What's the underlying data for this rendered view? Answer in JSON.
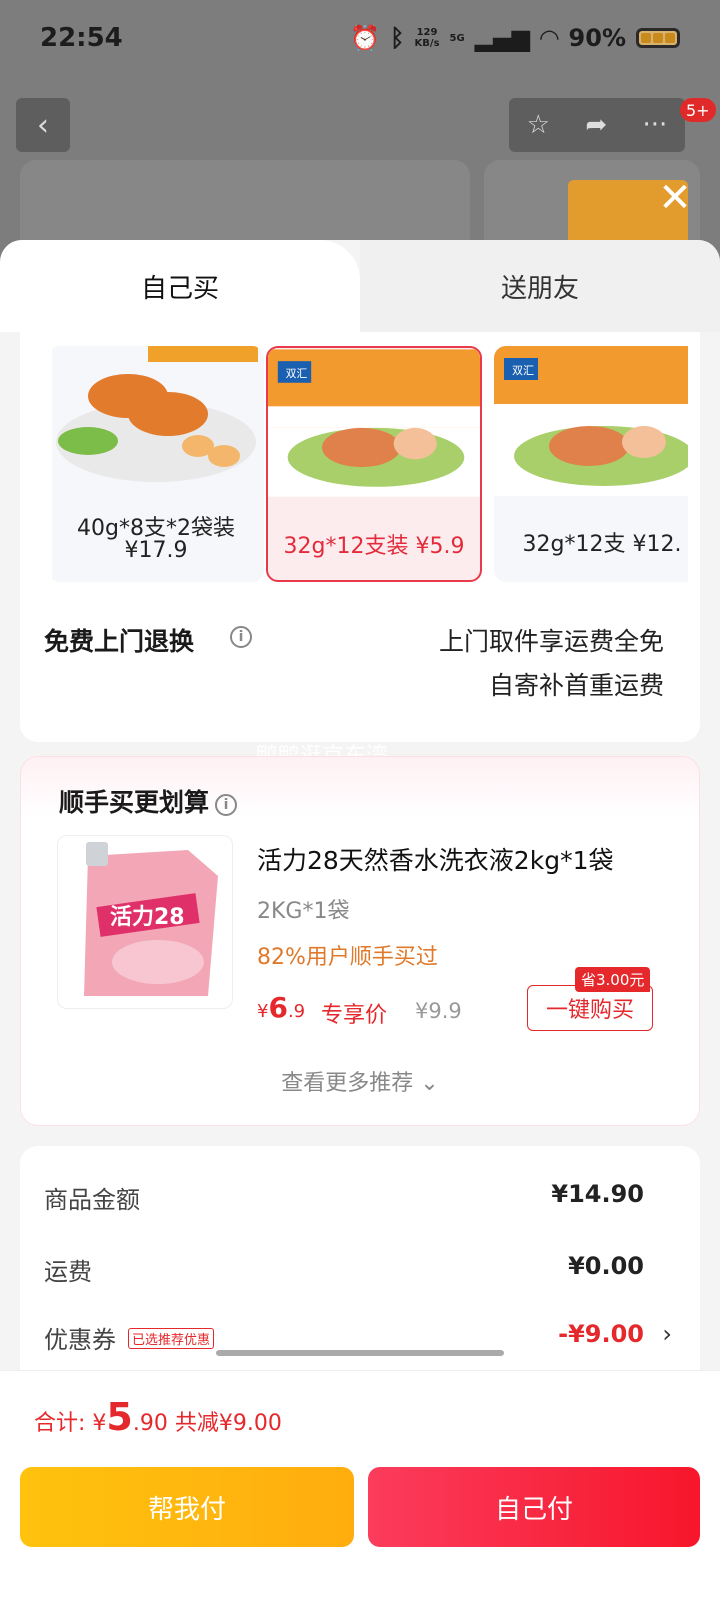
{
  "status_bar": {
    "time": "22:54",
    "net_speed_top": "129",
    "net_speed_bottom": "KB/s",
    "signal": "5G",
    "battery": "90%"
  },
  "background_page": {
    "badge": "5+"
  },
  "tabs": {
    "self_buy": "自己买",
    "gift_friend": "送朋友"
  },
  "skus": [
    {
      "label_line1": "40g*8支*2袋装",
      "label_line2": "¥17.9",
      "selected": false
    },
    {
      "label": "32g*12支装 ¥5.9",
      "selected": true
    },
    {
      "label": "32g*12支 ¥12.",
      "selected": false
    }
  ],
  "returns": {
    "title": "免费上门退换",
    "line1": "上门取件享运费全免",
    "line2": "自寄补首重运费"
  },
  "watermark": "鸭鸭逛京东湾",
  "recommend": {
    "title": "顺手买更划算",
    "product_name": "活力28天然香水洗衣液2kg*1袋",
    "spec": "2KG*1袋",
    "buy_rate": "82%用户顺手买过",
    "price_symbol": "¥",
    "price_int": "6",
    "price_dec": ".9",
    "price_tag": "专享价",
    "original_price": "¥9.9",
    "save_badge": "省3.00元",
    "buy_button": "一键购买",
    "more": "查看更多推荐 ⌄"
  },
  "summary": {
    "goods_label": "商品金额",
    "goods_value": "¥14.90",
    "shipping_label": "运费",
    "shipping_value": "¥0.00",
    "coupon_label": "优惠券",
    "coupon_tag": "已选推荐优惠",
    "coupon_value": "-¥9.00"
  },
  "footer": {
    "total_prefix": "合计: ¥",
    "total_int": "5",
    "total_dec": ".90",
    "total_saved": " 共减¥9.00",
    "help_pay": "帮我付",
    "self_pay": "自己付"
  },
  "colors": {
    "accent_red": "#e5282b",
    "help_yellow": "#ffb80e",
    "self_pay_red": "#f72a42"
  }
}
